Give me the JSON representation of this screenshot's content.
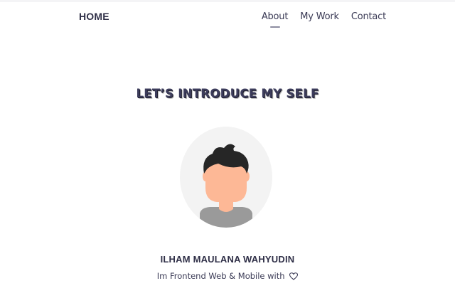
{
  "navbar": {
    "brand": "HOME",
    "links": [
      {
        "label": "About",
        "active": true
      },
      {
        "label": "My Work",
        "active": false
      },
      {
        "label": "Contact",
        "active": false
      }
    ]
  },
  "hero": {
    "headline": "LET’S INTRODUCE MY SELF",
    "avatar_icon": "person-avatar-illustration",
    "name": "ILHAM MAULANA WAHYUDIN",
    "tagline": "Im Frontend Web & Mobile with",
    "tagline_icon": "heart-icon"
  },
  "colors": {
    "text": "#33334d",
    "avatar_bg": "#f3f3f3",
    "skin": "#fdb896",
    "hair": "#262626",
    "shirt": "#9a9a9a"
  }
}
